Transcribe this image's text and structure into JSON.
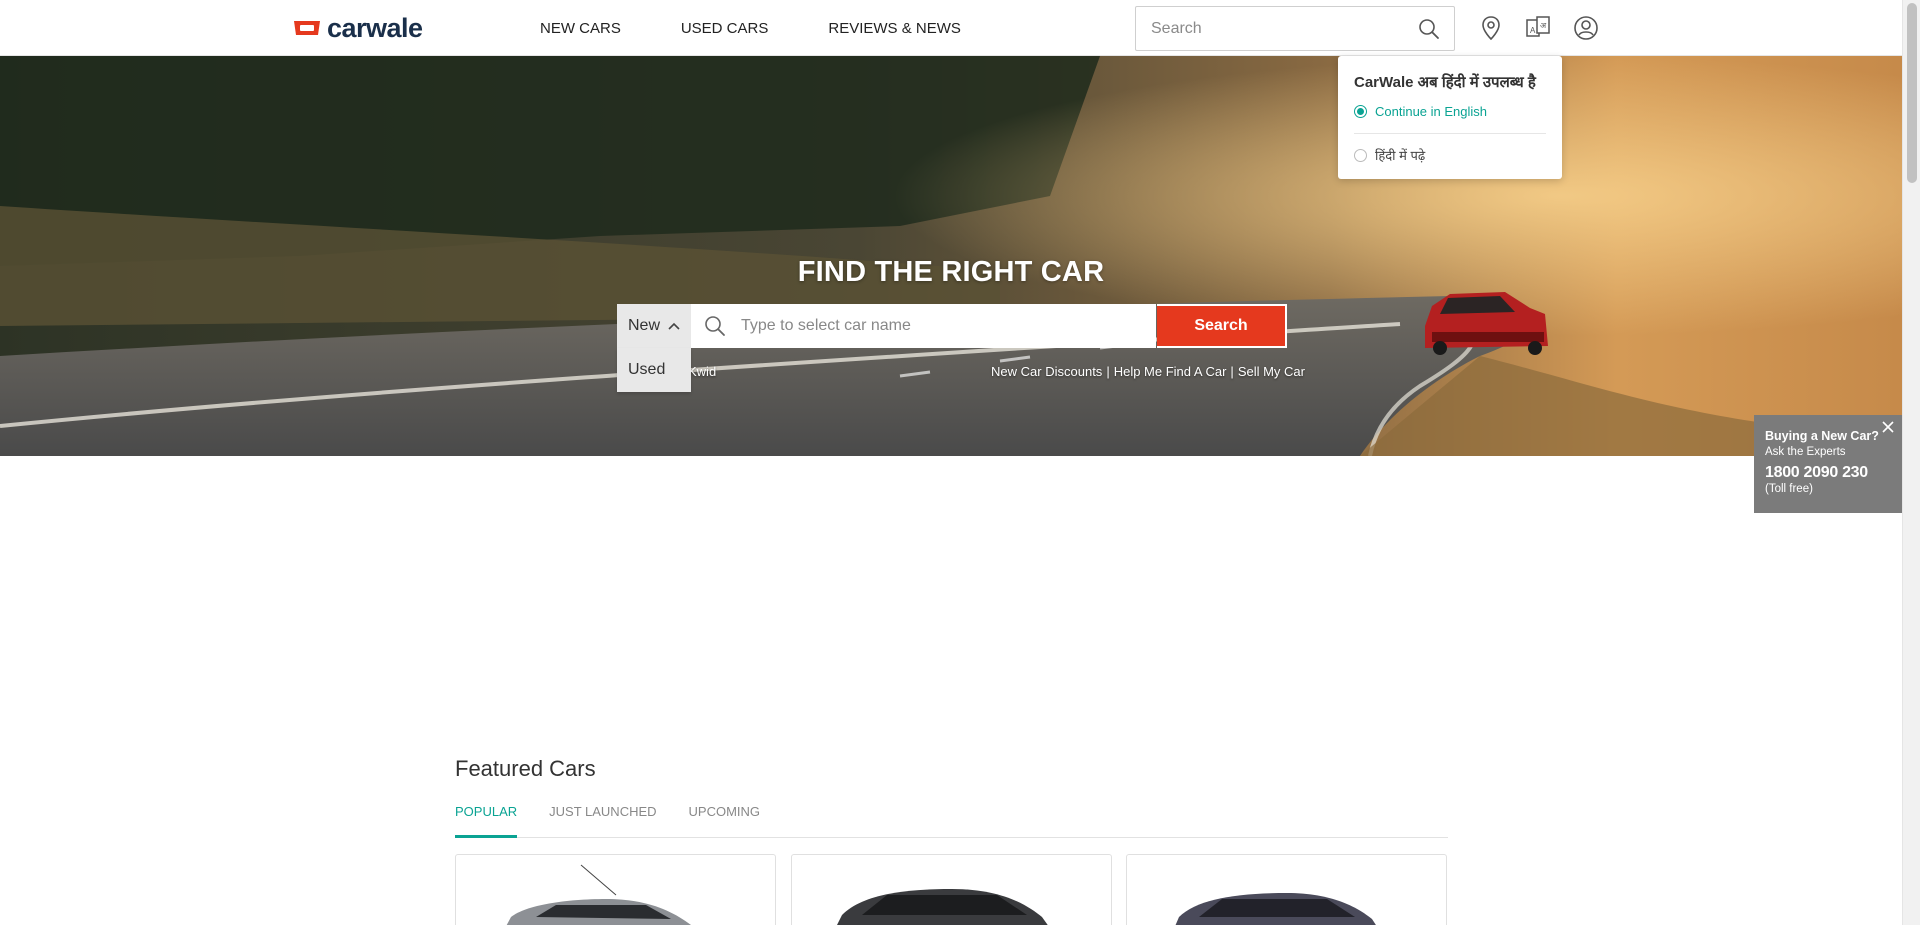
{
  "brand": {
    "name": "carwale",
    "accent": "#e5391e",
    "teal": "#0aa393"
  },
  "nav": {
    "items": [
      "NEW CARS",
      "USED CARS",
      "REVIEWS & NEWS"
    ]
  },
  "header": {
    "search_placeholder": "Search",
    "icons": [
      "location-pin-icon",
      "language-icon",
      "user-account-icon"
    ]
  },
  "language_popup": {
    "title": "CarWale अब हिंदी में उपलब्ध है",
    "option_english": "Continue in English",
    "option_hindi": "हिंदी में पढ़े",
    "selected": "english"
  },
  "hero": {
    "title": "FIND THE RIGHT CAR",
    "type_selected": "New",
    "type_options": [
      "Used"
    ],
    "input_placeholder": "Type to select car name",
    "search_label": "Search",
    "trending_text": "Kwid",
    "links": [
      "New Car Discounts",
      "Help Me Find A Car",
      "Sell My Car"
    ],
    "link_separator": "|"
  },
  "expert_popup": {
    "line1": "Buying a New Car?",
    "line2": "Ask the Experts",
    "phone": "1800 2090 230",
    "note": "(Toll free)"
  },
  "featured": {
    "title": "Featured Cars",
    "tabs": [
      "POPULAR",
      "JUST LAUNCHED",
      "UPCOMING"
    ],
    "active_tab": 0
  }
}
